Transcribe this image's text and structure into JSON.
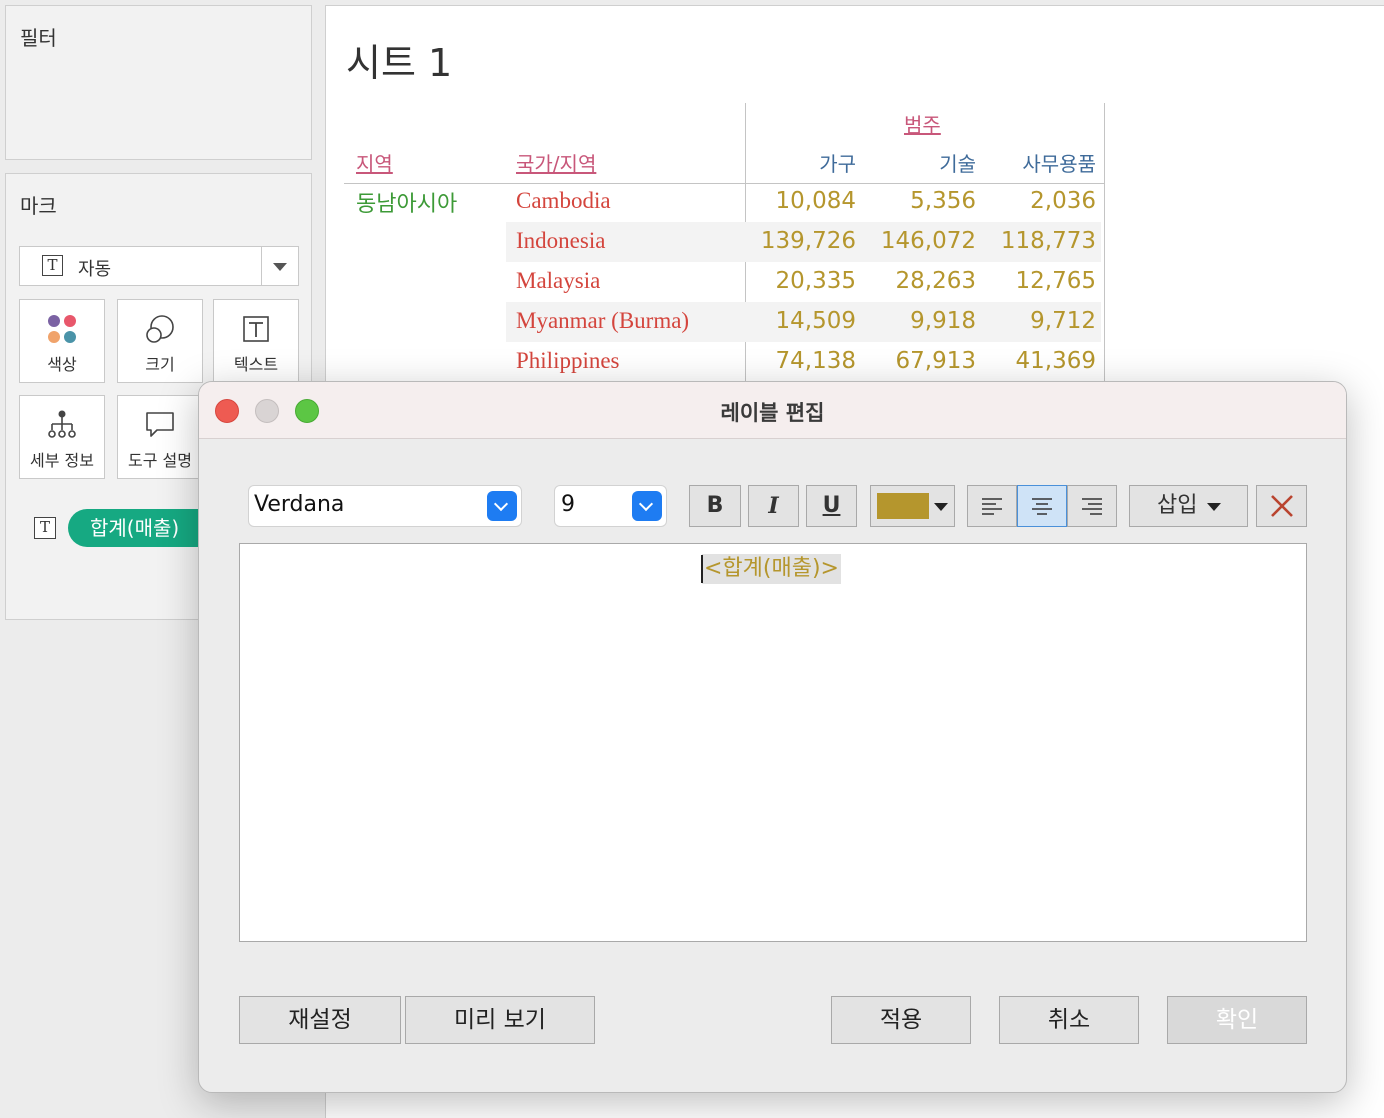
{
  "filters": {
    "title": "필터"
  },
  "marks": {
    "title": "마크",
    "mark_type": "자동",
    "cards": [
      {
        "label": "색상",
        "icon": "color-dots-icon"
      },
      {
        "label": "크기",
        "icon": "size-circles-icon"
      },
      {
        "label": "텍스트",
        "icon": "text-t-icon"
      },
      {
        "label": "세부 정보",
        "icon": "detail-tree-icon"
      },
      {
        "label": "도구 설명",
        "icon": "tooltip-bubble-icon"
      }
    ],
    "pill": "합계(매출)"
  },
  "sheet": {
    "title": "시트 1",
    "headers": {
      "region": "지역",
      "country": "국가/지역",
      "category": "범주"
    },
    "columns": [
      "가구",
      "기술",
      "사무용품"
    ],
    "region_value": "동남아시아",
    "rows": [
      {
        "country": "Cambodia",
        "values": [
          "10,084",
          "5,356",
          "2,036"
        ]
      },
      {
        "country": "Indonesia",
        "values": [
          "139,726",
          "146,072",
          "118,773"
        ]
      },
      {
        "country": "Malaysia",
        "values": [
          "20,335",
          "28,263",
          "12,765"
        ]
      },
      {
        "country": "Myanmar (Burma)",
        "values": [
          "14,509",
          "9,918",
          "9,712"
        ]
      },
      {
        "country": "Philippines",
        "values": [
          "74,138",
          "67,913",
          "41,369"
        ]
      }
    ]
  },
  "dialog": {
    "title": "레이블 편집",
    "font": "Verdana",
    "size": "9",
    "bold": "B",
    "italic": "I",
    "underline": "U",
    "font_color": "#b5962d",
    "insert_label": "삽입",
    "field_text": "<합계(매출)>",
    "buttons": {
      "reset": "재설정",
      "preview": "미리 보기",
      "apply": "적용",
      "cancel": "취소",
      "ok": "확인"
    },
    "colors": {
      "region": "#3d9a37",
      "country": "#d4453d",
      "value": "#b5962d",
      "header": "#c8577a",
      "column": "#3f6b9a",
      "pill": "#16a982"
    }
  }
}
